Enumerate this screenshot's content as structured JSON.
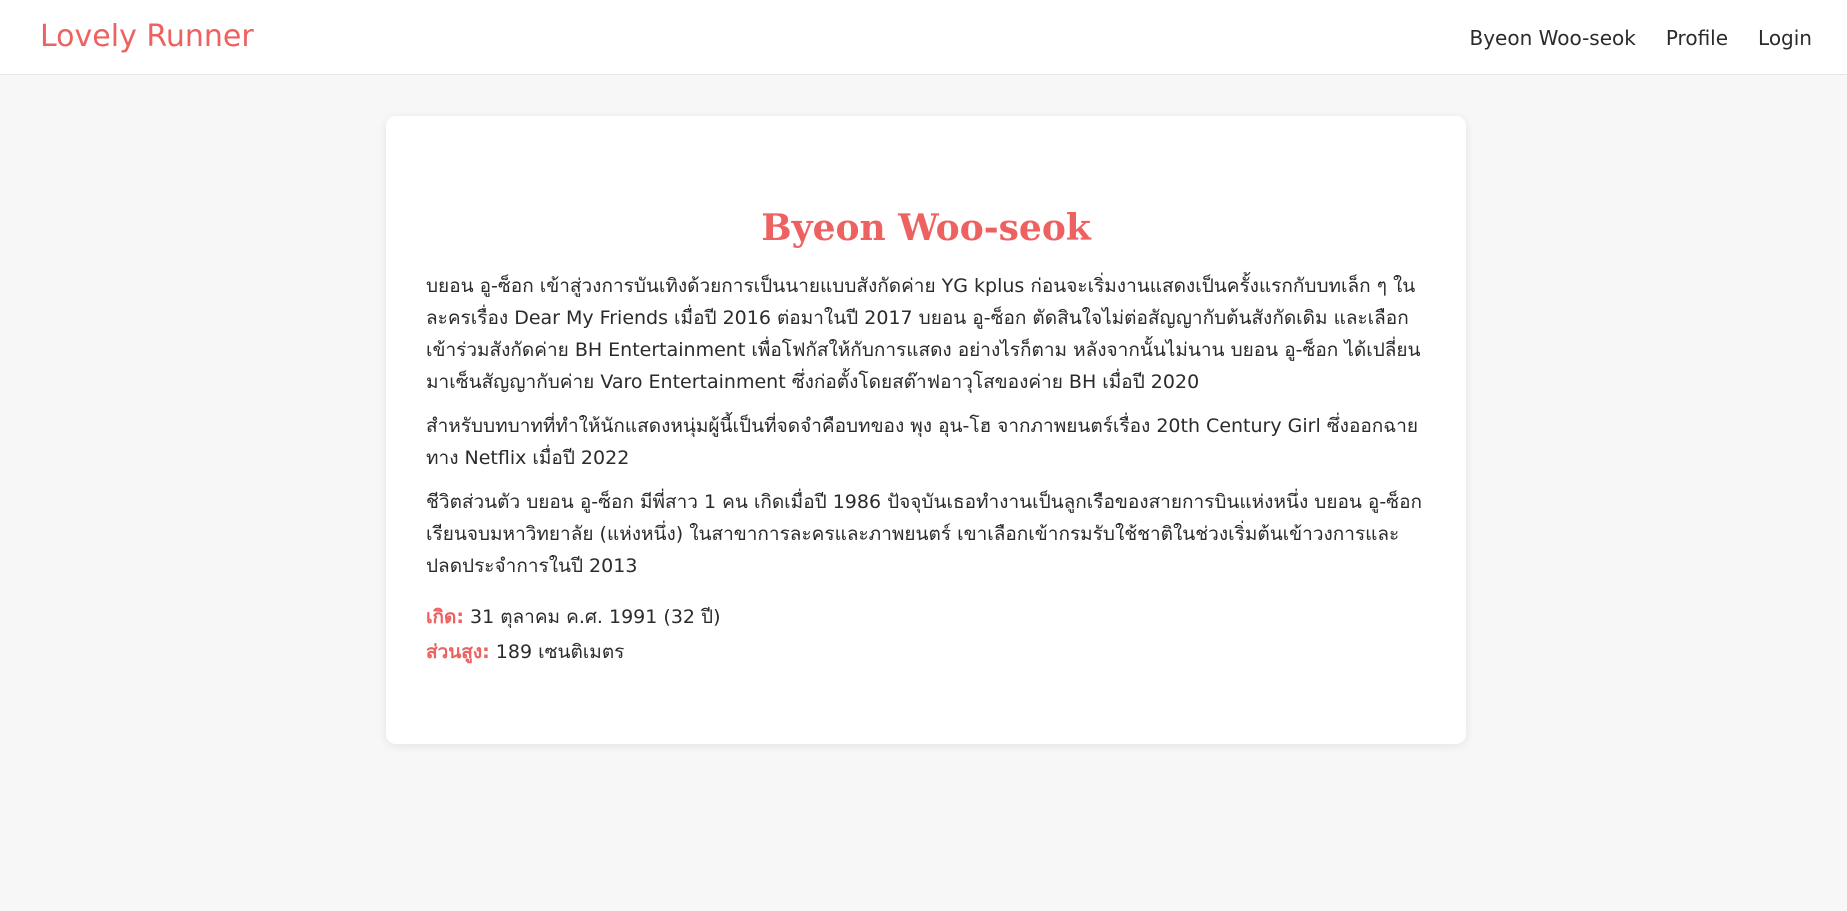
{
  "navbar": {
    "brand": "Lovely Runner",
    "links": [
      {
        "label": "Byeon Woo-seok"
      },
      {
        "label": "Profile"
      },
      {
        "label": "Login"
      }
    ]
  },
  "profile": {
    "name": "Byeon Woo-seok",
    "paragraphs": [
      "บยอน อู-ซ็อก เข้าสู่วงการบันเทิงด้วยการเป็นนายแบบสังกัดค่าย YG kplus ก่อนจะเริ่มงานแสดงเป็นครั้งแรกกับบทเล็ก ๆ ในละครเรื่อง Dear My Friends เมื่อปี 2016 ต่อมาในปี 2017 บยอน อู-ซ็อก ตัดสินใจไม่ต่อสัญญากับต้นสังกัดเดิม และเลือกเข้าร่วมสังกัดค่าย BH Entertainment เพื่อโฟกัสให้กับการแสดง อย่างไรก็ตาม หลังจากนั้นไม่นาน บยอน อู-ซ็อก ได้เปลี่ยนมาเซ็นสัญญากับค่าย Varo Entertainment ซึ่งก่อตั้งโดยสต๊าฟอาวุโสของค่าย BH เมื่อปี 2020",
      "สำหรับบทบาทที่ทำให้นักแสดงหนุ่มผู้นี้เป็นที่จดจำคือบทของ พุง อุน-โฮ จากภาพยนตร์เรื่อง 20th Century Girl ซึ่งออกฉายทาง Netflix เมื่อปี 2022",
      "ชีวิตส่วนตัว บยอน อู-ซ็อก มีพี่สาว 1 คน เกิดเมื่อปี 1986 ปัจจุบันเธอทำงานเป็นลูกเรือของสายการบินแห่งหนึ่ง บยอน อู-ซ็อก เรียนจบมหาวิทยาลัย (แห่งหนึ่ง) ในสาขาการละครและภาพยนตร์ เขาเลือกเข้ากรมรับใช้ชาติในช่วงเริ่มต้นเข้าวงการและปลดประจำการในปี 2013"
    ],
    "birth_label": "เกิด:",
    "birth_value": " 31 ตุลาคม ค.ศ. 1991 (32 ปี)",
    "height_label": "ส่วนสูง:",
    "height_value": " 189 เซนติเมตร"
  },
  "colors": {
    "accent": "#ee6161",
    "background": "#f7f7f8",
    "card": "#ffffff"
  }
}
